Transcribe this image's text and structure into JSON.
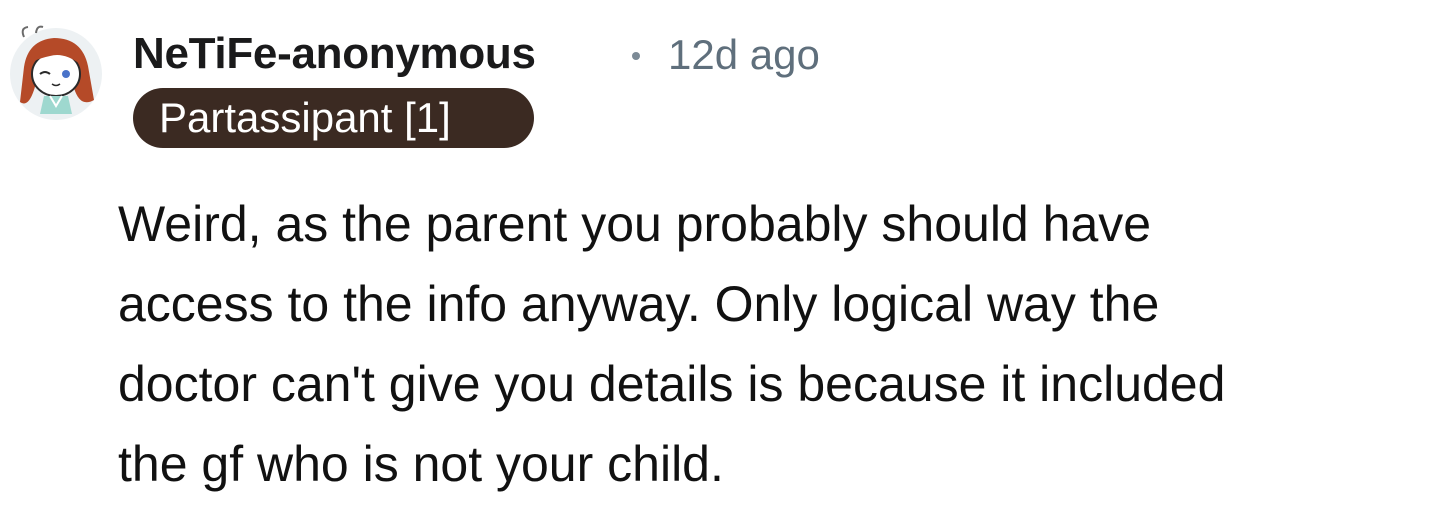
{
  "comment": {
    "author": "NeTiFe-anonymous",
    "timestamp": "12d ago",
    "flair": "Partassipant [1]",
    "avatar_icon": "user-avatar-icon",
    "body_lines": [
      "Weird, as the parent you probably should have",
      "access to the info anyway. Only logical way the",
      "doctor can't give you details is because it included",
      "the gf who is not your child."
    ]
  },
  "colors": {
    "flair_background": "#3b2a22",
    "timestamp": "#5f6f7c",
    "text": "#1a1a1b"
  }
}
